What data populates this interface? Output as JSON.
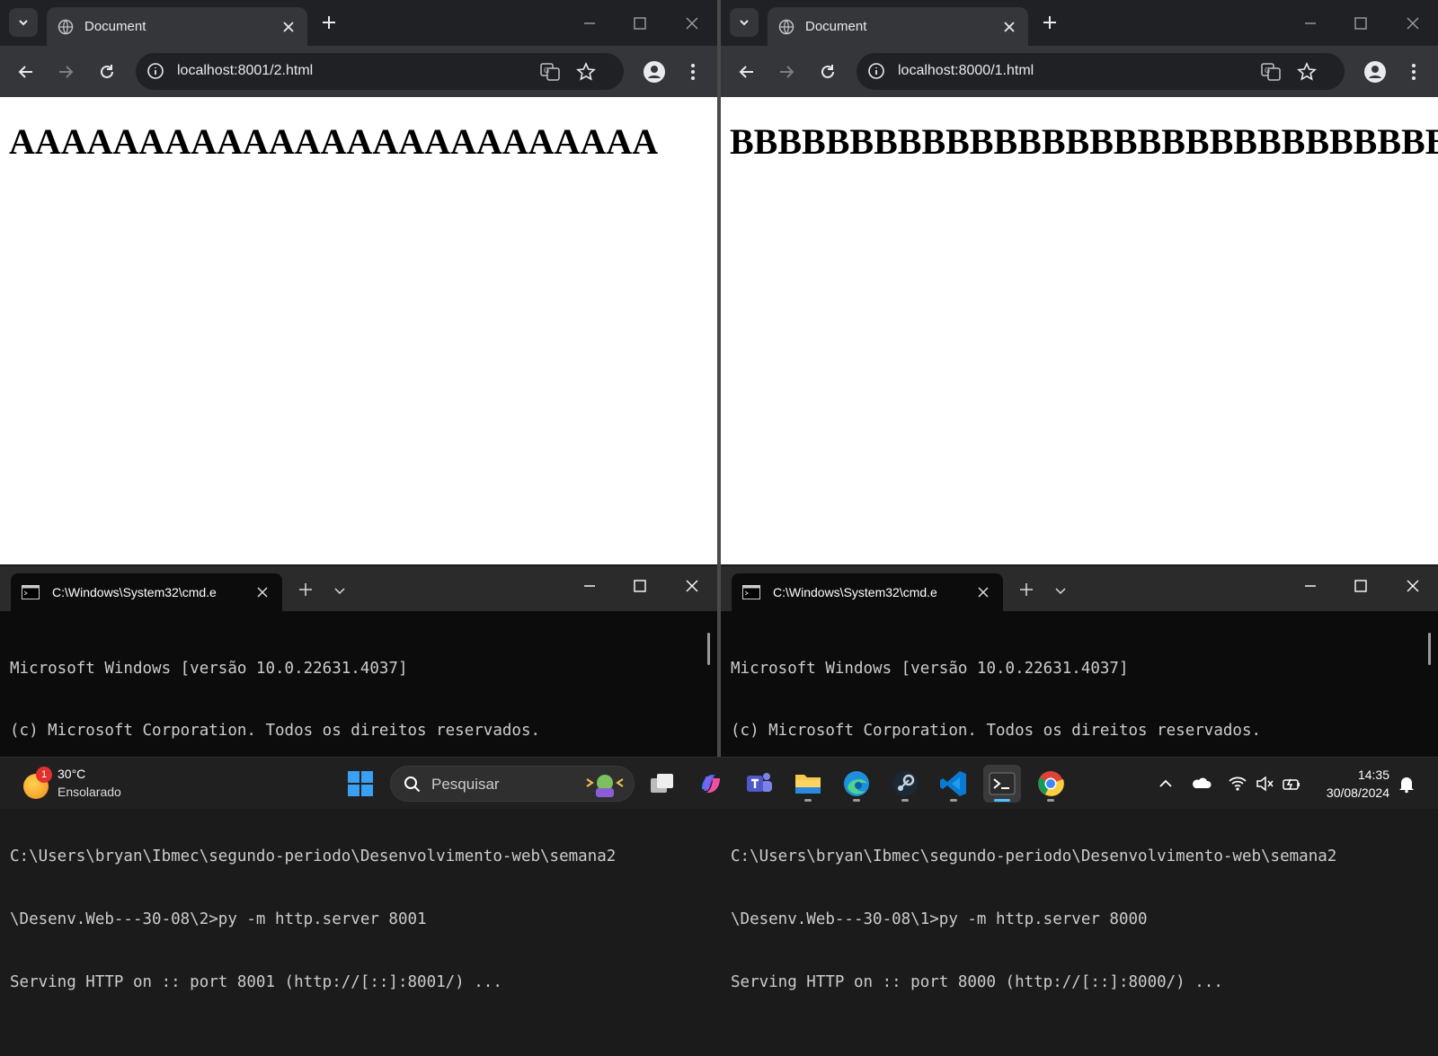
{
  "left_browser": {
    "tab_title": "Document",
    "url": "localhost:8001/2.html",
    "page_text": "AAAAAAAAAAAAAAAAAAAAAAAAA"
  },
  "right_browser": {
    "tab_title": "Document",
    "url": "localhost:8000/1.html",
    "page_text": "BBBBBBBBBBBBBBBBBBBBBBBBBBBBBBBB"
  },
  "left_terminal": {
    "tab_title": "C:\\Windows\\System32\\cmd.e",
    "lines": [
      "Microsoft Windows [versão 10.0.22631.4037]",
      "(c) Microsoft Corporation. Todos os direitos reservados.",
      "",
      "C:\\Users\\bryan\\Ibmec\\segundo-periodo\\Desenvolvimento-web\\semana2",
      "\\Desenv.Web---30-08\\2>py -m http.server 8001",
      "Serving HTTP on :: port 8001 (http://[::]:8001/) ..."
    ]
  },
  "right_terminal": {
    "tab_title": "C:\\Windows\\System32\\cmd.e",
    "lines": [
      "Microsoft Windows [versão 10.0.22631.4037]",
      "(c) Microsoft Corporation. Todos os direitos reservados.",
      "",
      "C:\\Users\\bryan\\Ibmec\\segundo-periodo\\Desenvolvimento-web\\semana2",
      "\\Desenv.Web---30-08\\1>py -m http.server 8000",
      "Serving HTTP on :: port 8000 (http://[::]:8000/) ..."
    ]
  },
  "taskbar": {
    "weather_badge": "1",
    "weather_temp": "30°C",
    "weather_desc": "Ensolarado",
    "search_placeholder": "Pesquisar",
    "clock_time": "14:35",
    "clock_date": "30/08/2024",
    "pinned_apps": [
      "windows-start",
      "task-view",
      "copilot",
      "teams",
      "file-explorer",
      "edge",
      "steam",
      "vscode",
      "terminal",
      "chrome"
    ],
    "accent_color": "#4cc2ff"
  }
}
